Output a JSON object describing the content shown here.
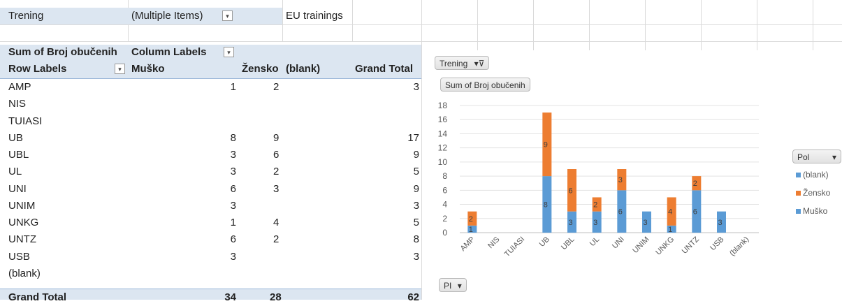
{
  "filter": {
    "field": "Trening",
    "value": "(Multiple Items)",
    "note": "EU trainings"
  },
  "pivot": {
    "values_label": "Sum of Broj obučenih",
    "column_labels": "Column Labels",
    "row_labels": "Row Labels",
    "columns": [
      "Muško",
      "Žensko",
      "(blank)",
      "Grand Total"
    ],
    "rows": [
      {
        "label": "AMP",
        "musko": "1",
        "zensko": "2",
        "blank": "",
        "total": "3"
      },
      {
        "label": "NIS",
        "musko": "",
        "zensko": "",
        "blank": "",
        "total": ""
      },
      {
        "label": "TUIASI",
        "musko": "",
        "zensko": "",
        "blank": "",
        "total": ""
      },
      {
        "label": "UB",
        "musko": "8",
        "zensko": "9",
        "blank": "",
        "total": "17"
      },
      {
        "label": "UBL",
        "musko": "3",
        "zensko": "6",
        "blank": "",
        "total": "9"
      },
      {
        "label": "UL",
        "musko": "3",
        "zensko": "2",
        "blank": "",
        "total": "5"
      },
      {
        "label": "UNI",
        "musko": "6",
        "zensko": "3",
        "blank": "",
        "total": "9"
      },
      {
        "label": "UNIM",
        "musko": "3",
        "zensko": "",
        "blank": "",
        "total": "3"
      },
      {
        "label": "UNKG",
        "musko": "1",
        "zensko": "4",
        "blank": "",
        "total": "5"
      },
      {
        "label": "UNTZ",
        "musko": "6",
        "zensko": "2",
        "blank": "",
        "total": "8"
      },
      {
        "label": "USB",
        "musko": "3",
        "zensko": "",
        "blank": "",
        "total": "3"
      },
      {
        "label": "(blank)",
        "musko": "",
        "zensko": "",
        "blank": "",
        "total": ""
      }
    ],
    "grand_total": {
      "label": "Grand Total",
      "musko": "34",
      "zensko": "28",
      "blank": "",
      "total": "62"
    }
  },
  "chart_buttons": {
    "filter_chip": "Trening",
    "values_chip": "Sum of Broj obučenih",
    "axis_chip": "PI",
    "legend_chip": "Pol"
  },
  "colors": {
    "musko": "#5b9bd5",
    "zensko": "#ed7d31",
    "header_band": "#dce6f1"
  },
  "chart_data": {
    "type": "bar",
    "stacked": true,
    "categories": [
      "AMP",
      "NIS",
      "TUIASI",
      "UB",
      "UBL",
      "UL",
      "UNI",
      "UNIM",
      "UNKG",
      "UNTZ",
      "USB",
      "(blank)"
    ],
    "series": [
      {
        "name": "Muško",
        "values": [
          1,
          0,
          0,
          8,
          3,
          3,
          6,
          3,
          1,
          6,
          3,
          0
        ]
      },
      {
        "name": "Žensko",
        "values": [
          2,
          0,
          0,
          9,
          6,
          2,
          3,
          0,
          4,
          2,
          0,
          0
        ]
      },
      {
        "name": "(blank)",
        "values": [
          0,
          0,
          0,
          0,
          0,
          0,
          0,
          0,
          0,
          0,
          0,
          0
        ]
      }
    ],
    "ylim": [
      0,
      18
    ],
    "yticks": [
      "0",
      "2",
      "4",
      "6",
      "8",
      "10",
      "12",
      "14",
      "16",
      "18"
    ],
    "grid": true,
    "legend_position": "right"
  }
}
